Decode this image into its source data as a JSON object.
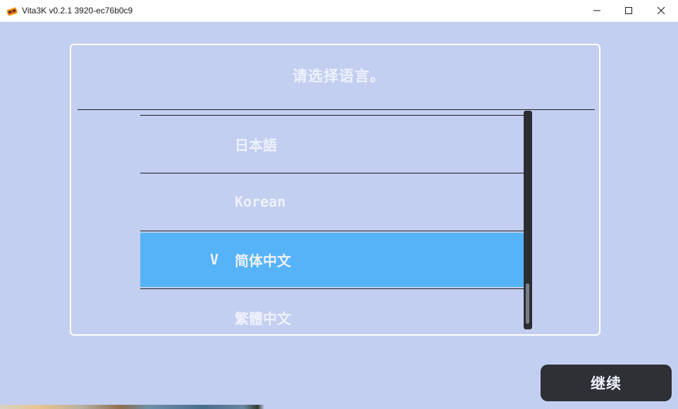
{
  "window": {
    "title": "Vita3K v0.2.1 3920-ec76b0c9",
    "icon": "vita3k-app-icon",
    "controls": [
      "minimize-icon",
      "maximize-icon",
      "close-icon"
    ]
  },
  "dialog": {
    "title": "请选择语言。",
    "languages": [
      {
        "label": "日本語",
        "selected": false
      },
      {
        "label": "Korean",
        "selected": false
      },
      {
        "label": "简体中文",
        "selected": true,
        "mark": "V"
      },
      {
        "label": "繁體中文",
        "selected": false
      }
    ],
    "scroll_position": 0.86
  },
  "continue_button": {
    "label": "继续"
  },
  "colors": {
    "background": "#c3cff0",
    "selected_row": "#56b3f8",
    "button": "#2e3036",
    "text": "#eef1fb"
  }
}
